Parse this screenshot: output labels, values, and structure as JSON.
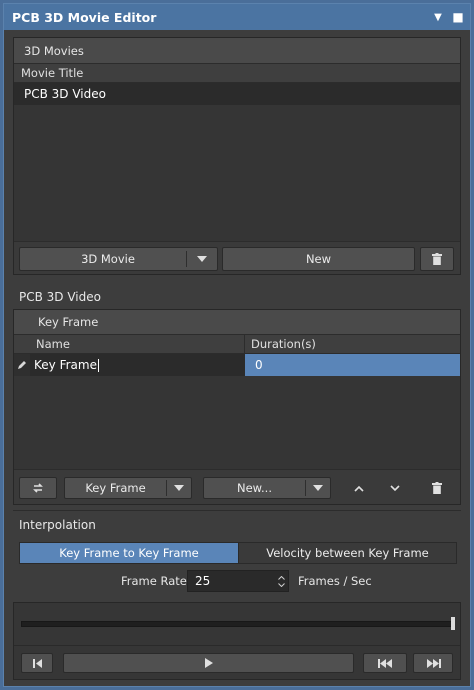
{
  "window": {
    "title": "PCB 3D Movie Editor",
    "menu_icon": "dropdown-arrow-icon",
    "pin_icon": "pin-icon"
  },
  "movies": {
    "group_label": "3D Movies",
    "column_header": "Movie Title",
    "items": [
      "PCB 3D Video"
    ],
    "movie_button_label": "3D Movie",
    "new_button_label": "New"
  },
  "video": {
    "section_label": "PCB 3D Video",
    "group_label": "Key Frame",
    "columns": {
      "name": "Name",
      "duration": "Duration(s)"
    },
    "rows": [
      {
        "name": "Key Frame",
        "duration": "0"
      }
    ],
    "key_frame_button_label": "Key Frame",
    "new_button_label": "New..."
  },
  "interpolation": {
    "section_label": "Interpolation",
    "options": [
      "Key Frame to Key Frame",
      "Velocity between Key Frame"
    ],
    "selected_index": 0,
    "frame_rate_label": "Frame Rate",
    "frame_rate_value": "25",
    "frame_rate_unit": "Frames / Sec"
  },
  "playback": {
    "position": 1.0
  },
  "colors": {
    "accent": "#5a85b8",
    "title_bar": "#4b74a2",
    "panel": "#3d3d3d"
  }
}
